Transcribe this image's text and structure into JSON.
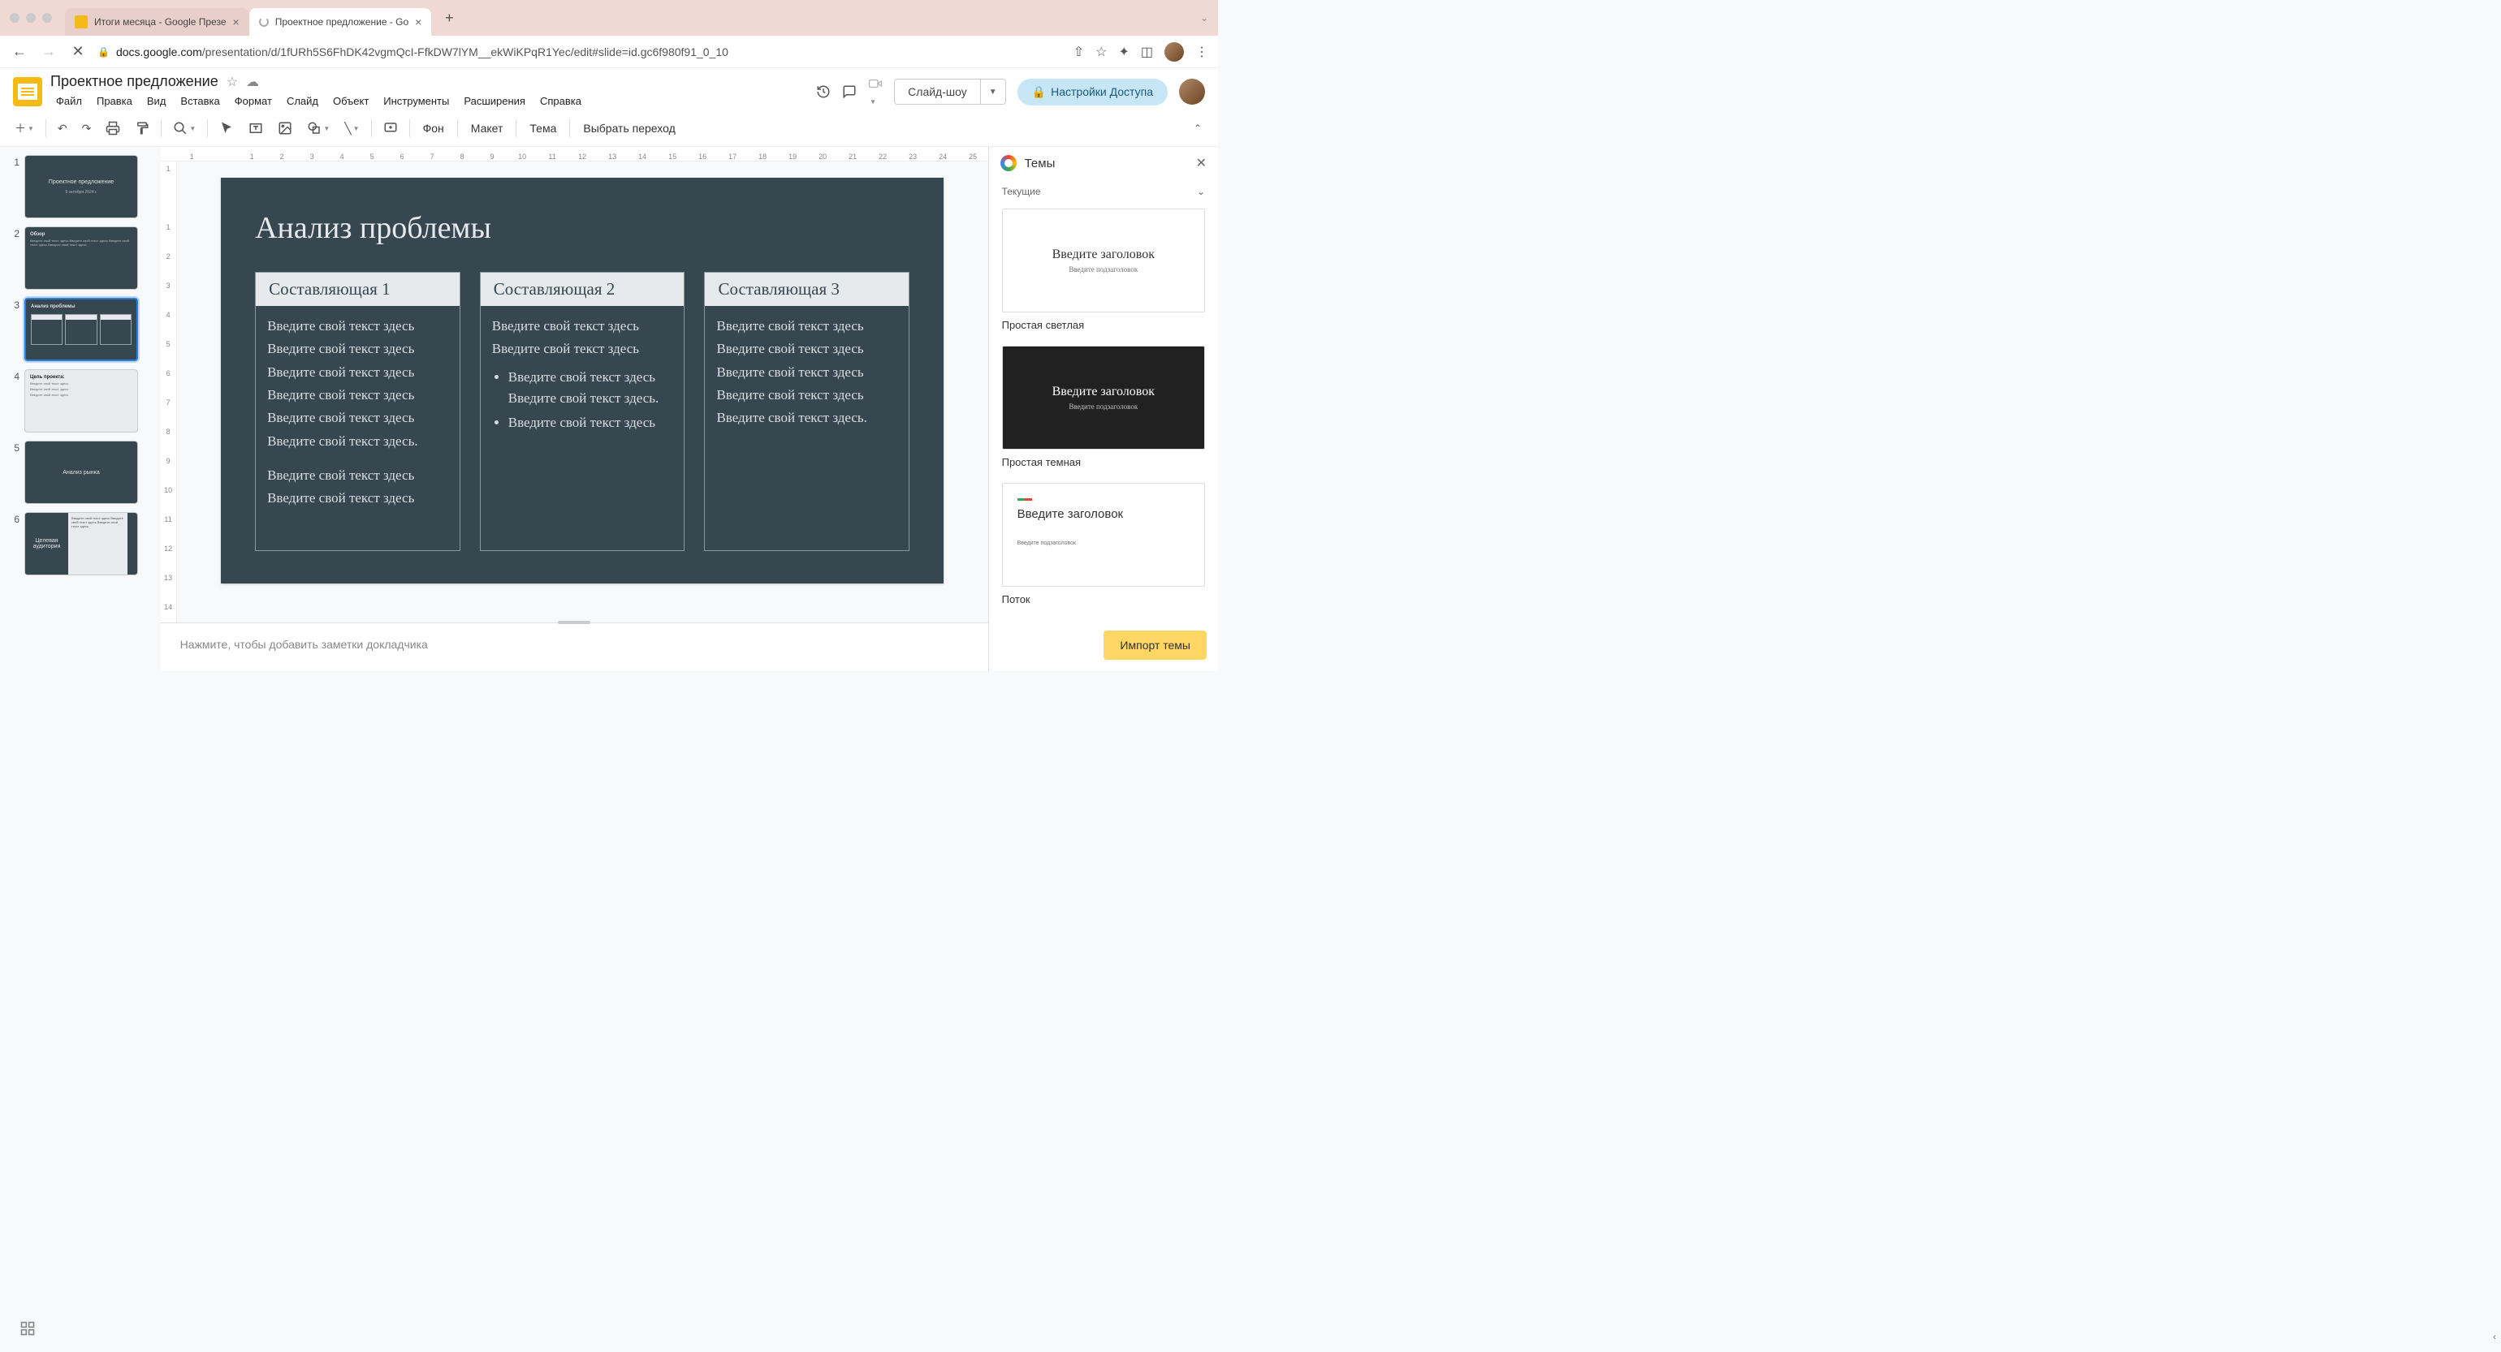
{
  "browser": {
    "tabs": [
      {
        "title": "Итоги месяца - Google Презе",
        "active": false
      },
      {
        "title": "Проектное предложение - Go",
        "active": true,
        "loading": true
      }
    ],
    "url_host": "docs.google.com",
    "url_path": "/presentation/d/1fURh5S6FhDK42vgmQcI-FfkDW7lYM__ekWiKPqR1Yec/edit#slide=id.gc6f980f91_0_10"
  },
  "doc": {
    "name": "Проектное предложение",
    "menus": [
      "Файл",
      "Правка",
      "Вид",
      "Вставка",
      "Формат",
      "Слайд",
      "Объект",
      "Инструменты",
      "Расширения",
      "Справка"
    ]
  },
  "header_buttons": {
    "slideshow": "Слайд-шоу",
    "share": "Настройки Доступа"
  },
  "toolbar": {
    "bg": "Фон",
    "layout": "Макет",
    "theme": "Тема",
    "transition": "Выбрать переход"
  },
  "ruler_h": [
    "1",
    "",
    "1",
    "2",
    "3",
    "4",
    "5",
    "6",
    "7",
    "8",
    "9",
    "10",
    "11",
    "12",
    "13",
    "14",
    "15",
    "16",
    "17",
    "18",
    "19",
    "20",
    "21",
    "22",
    "23",
    "24",
    "25"
  ],
  "ruler_v": [
    "1",
    "",
    "1",
    "2",
    "3",
    "4",
    "5",
    "6",
    "7",
    "8",
    "9",
    "10",
    "11",
    "12",
    "13",
    "14"
  ],
  "thumbs": [
    {
      "n": "1",
      "title": "Проектное предложение",
      "sub": "5 октября 2024 г."
    },
    {
      "n": "2",
      "title": "Обзор",
      "body": "Введите свой текст здесь Введите свой текст здесь Введите свой текст здесь Введите свой текст здесь"
    },
    {
      "n": "3",
      "title": "Анализ проблемы",
      "selected": true
    },
    {
      "n": "4",
      "title": "Цель проекта:",
      "lines": [
        "Введите свой текст здесь",
        "Введите свой текст здесь",
        "Введите свой текст здесь"
      ]
    },
    {
      "n": "5",
      "title": "Анализ рынка"
    },
    {
      "n": "6",
      "title": "Целевая аудитория",
      "body": "Введите свой текст здесь Введите свой текст здесь Введите свой текст здесь"
    }
  ],
  "slide": {
    "title": "Анализ проблемы",
    "cols": [
      {
        "header": "Составляющая 1",
        "body1": [
          "Введите свой текст здесь",
          "Введите свой текст здесь",
          "Введите свой текст здесь",
          "Введите свой текст здесь",
          "Введите свой текст здесь",
          "Введите свой текст здесь."
        ],
        "body2": [
          "Введите свой текст здесь",
          "Введите свой текст здесь"
        ]
      },
      {
        "header": "Составляющая 2",
        "body1": [
          "Введите свой текст здесь",
          "Введите свой текст здесь"
        ],
        "bullets": [
          "Введите свой текст здесь Введите свой текст здесь.",
          "Введите свой текст здесь"
        ]
      },
      {
        "header": "Составляющая 3",
        "body1": [
          "Введите свой текст здесь",
          "Введите свой текст здесь",
          "Введите свой текст здесь",
          "Введите свой текст здесь",
          "Введите свой текст здесь."
        ]
      }
    ]
  },
  "notes_placeholder": "Нажмите, чтобы добавить заметки докладчика",
  "themes": {
    "title": "Темы",
    "section": "Текущие",
    "items": [
      {
        "name": "Простая светлая",
        "variant": "light",
        "tp_title": "Введите заголовок",
        "tp_sub": "Введите подзаголовок"
      },
      {
        "name": "Простая темная",
        "variant": "dark",
        "tp_title": "Введите заголовок",
        "tp_sub": "Введите подзаголовок"
      },
      {
        "name": "Поток",
        "variant": "flow",
        "tp_title": "Введите заголовок",
        "tp_sub": "Введите подзаголовок"
      }
    ],
    "import": "Импорт темы"
  }
}
